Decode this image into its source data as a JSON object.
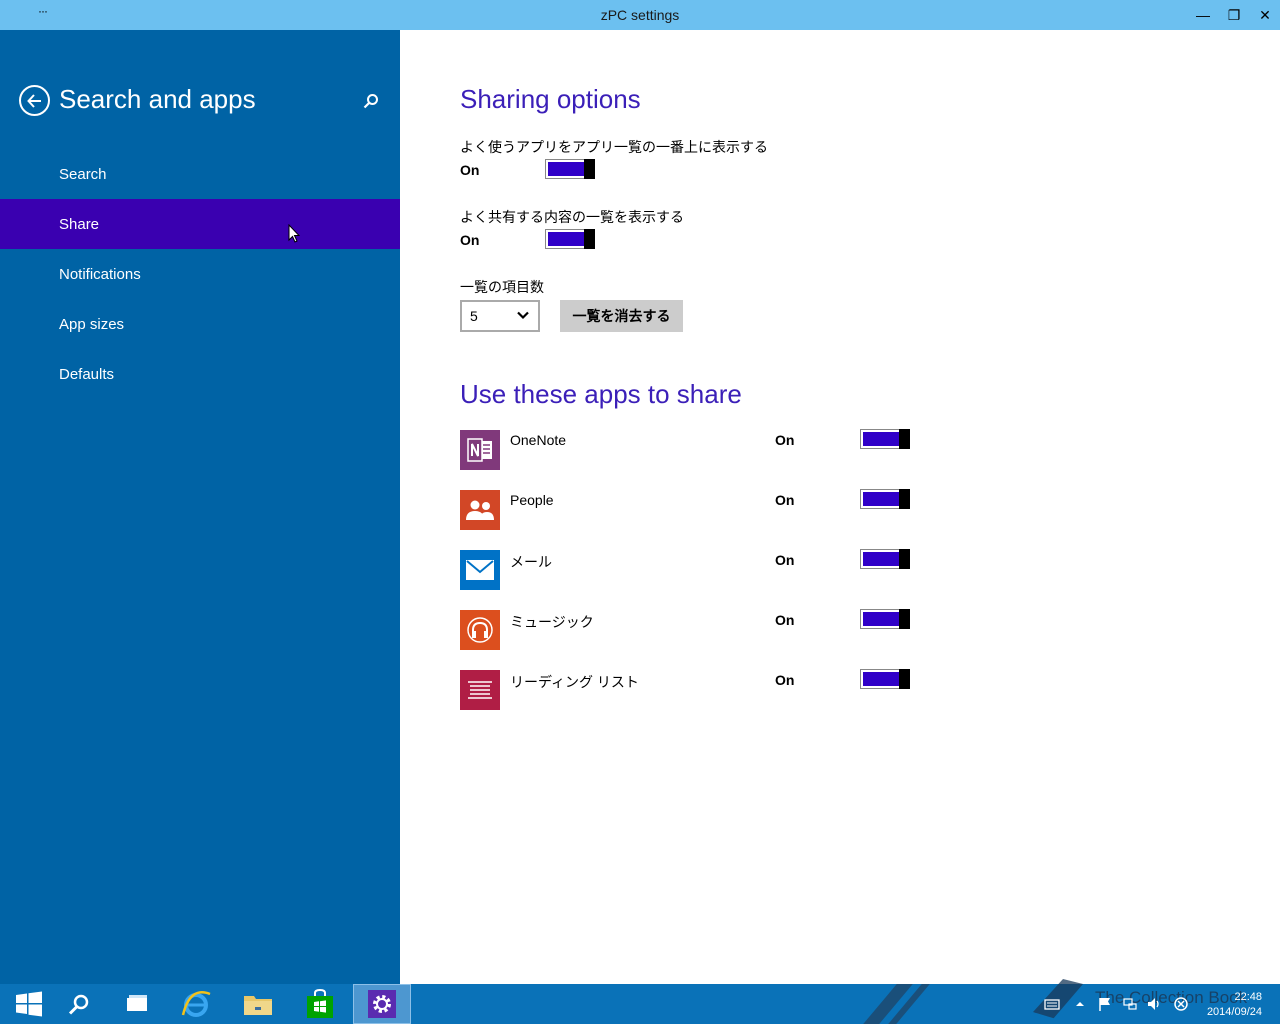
{
  "window": {
    "title": "zPC settings",
    "menu_glyph": "···",
    "minimize_glyph": "—",
    "maximize_glyph": "❐",
    "close_glyph": "✕"
  },
  "sidebar": {
    "heading": "Search and apps",
    "items": [
      {
        "label": "Search",
        "active": false
      },
      {
        "label": "Share",
        "active": true
      },
      {
        "label": "Notifications",
        "active": false
      },
      {
        "label": "App sizes",
        "active": false
      },
      {
        "label": "Defaults",
        "active": false
      }
    ]
  },
  "sharing_options": {
    "title": "Sharing options",
    "option1": {
      "label": "よく使うアプリをアプリ一覧の一番上に表示する",
      "state": "On"
    },
    "option2": {
      "label": "よく共有する内容の一覧を表示する",
      "state": "On"
    },
    "count_label": "一覧の項目数",
    "count_value": "5",
    "clear_button": "一覧を消去する"
  },
  "share_apps": {
    "title": "Use these apps to share",
    "apps": [
      {
        "name": "OneNote",
        "state": "On",
        "icon": "onenote-icon",
        "color": "#80397b"
      },
      {
        "name": "People",
        "state": "On",
        "icon": "people-icon",
        "color": "#d24726"
      },
      {
        "name": "メール",
        "state": "On",
        "icon": "mail-icon",
        "color": "#0072c6"
      },
      {
        "name": "ミュージック",
        "state": "On",
        "icon": "music-icon",
        "color": "#dc4f1e"
      },
      {
        "name": "リーディング リスト",
        "state": "On",
        "icon": "reading-list-icon",
        "color": "#b01e45"
      }
    ]
  },
  "taskbar": {
    "time": "22:48",
    "date": "2014/09/24",
    "watermark": "The Collection Book"
  },
  "colors": {
    "sidebar_bg": "#0063a5",
    "nav_active": "#3a00b0",
    "accent_title": "#3b1fb8",
    "toggle_fill": "#3000c8",
    "titlebar": "#6cc0f0",
    "taskbar": "#0a72b8"
  }
}
